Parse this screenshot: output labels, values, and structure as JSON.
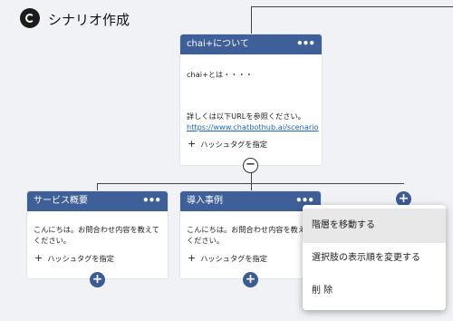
{
  "header": {
    "title": "シナリオ作成"
  },
  "cards": {
    "root": {
      "title": "chai+について",
      "body": "chai+とは・・・・",
      "detail": "詳しくは以下URLを参照ください。",
      "link": "https://www.chatbothub.ai/scenario",
      "tag": "ハッシュタグを指定"
    },
    "service": {
      "title": "サービス概要",
      "body": "こんにちは。お問合わせ内容を教えてください。",
      "tag": "ハッシュタグを指定"
    },
    "case": {
      "title": "導入事例",
      "body": "こんにちは。お問合わせ内容を教えてください。",
      "tag": "ハッシュタグを指定"
    }
  },
  "icons": {
    "menu": "•••",
    "collapse": "−",
    "add": "+"
  },
  "menu": {
    "items": [
      "階層を移動する",
      "選択肢の表示順を変更する",
      "削 除"
    ]
  }
}
